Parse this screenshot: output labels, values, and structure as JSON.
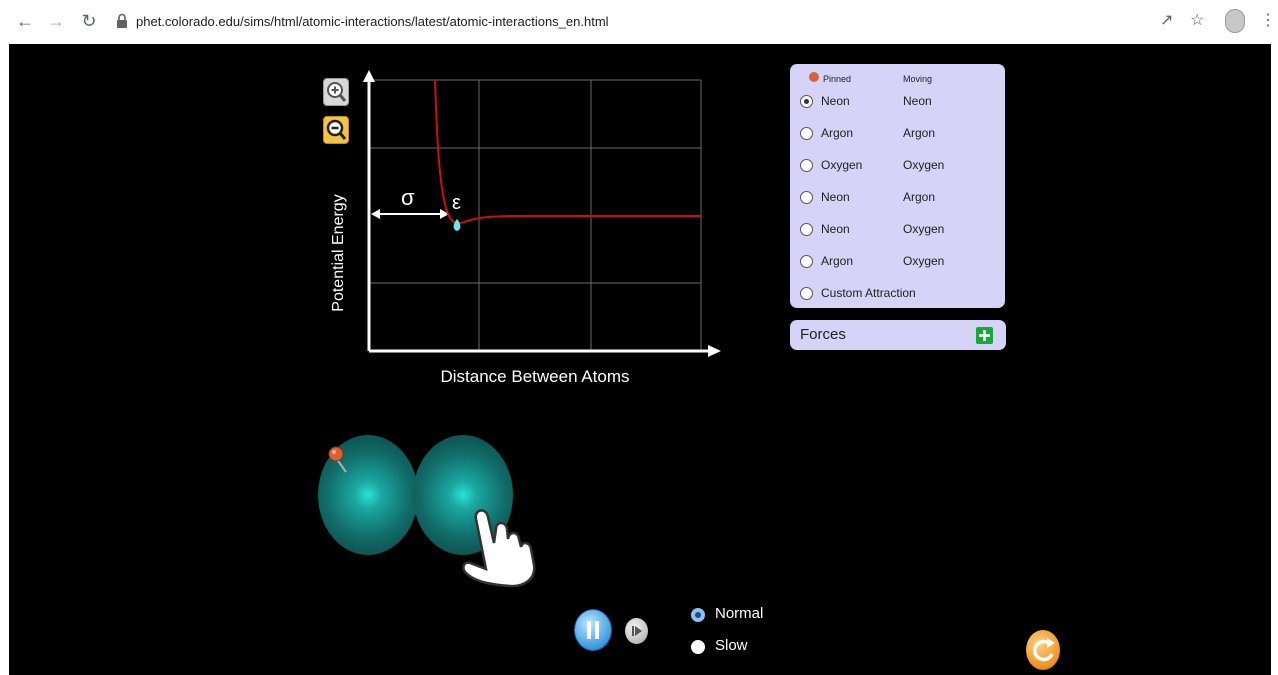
{
  "browser": {
    "url": "phet.colorado.edu/sims/html/atomic-interactions/latest/atomic-interactions_en.html"
  },
  "graph": {
    "y_axis_label": "Potential Energy",
    "x_axis_label": "Distance Between Atoms",
    "sigma_label": "σ",
    "epsilon_label": "ε",
    "curve_color": "#cc1010"
  },
  "atom_selector": {
    "pinned_header": "Pinned",
    "moving_header": "Moving",
    "selected_index": 0,
    "options": [
      {
        "pinned": "Neon",
        "moving": "Neon"
      },
      {
        "pinned": "Argon",
        "moving": "Argon"
      },
      {
        "pinned": "Oxygen",
        "moving": "Oxygen"
      },
      {
        "pinned": "Neon",
        "moving": "Argon"
      },
      {
        "pinned": "Neon",
        "moving": "Oxygen"
      },
      {
        "pinned": "Argon",
        "moving": "Oxygen"
      },
      {
        "pinned": "Custom Attraction",
        "moving": ""
      }
    ]
  },
  "forces_panel": {
    "title": "Forces",
    "accent": "#18a83a"
  },
  "playback": {
    "speed_normal": "Normal",
    "speed_slow": "Slow",
    "selected_speed": "Normal"
  },
  "colors": {
    "panel_bg": "#d5d3f7",
    "atom": "#1aa7a2",
    "background": "#000000"
  }
}
